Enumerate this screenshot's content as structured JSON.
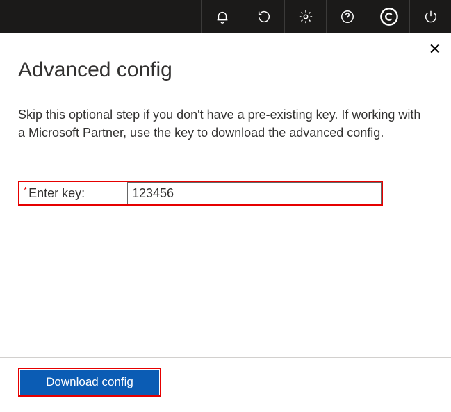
{
  "topbar": {
    "icons": [
      {
        "name": "bell-icon"
      },
      {
        "name": "refresh-icon"
      },
      {
        "name": "gear-icon"
      },
      {
        "name": "help-icon"
      },
      {
        "name": "copyright-icon"
      },
      {
        "name": "power-icon"
      }
    ]
  },
  "dialog": {
    "title": "Advanced config",
    "description": "Skip this optional step if you don't have a pre-existing key. If working with a Microsoft Partner, use the key to download the advanced config.",
    "field": {
      "required_marker": "*",
      "label": "Enter key:",
      "value": "123456"
    },
    "button_label": "Download config",
    "close_symbol": "✕"
  },
  "colors": {
    "highlight": "#e60000",
    "primary": "#0b5cb4",
    "topbar_bg": "#1b1a19"
  }
}
